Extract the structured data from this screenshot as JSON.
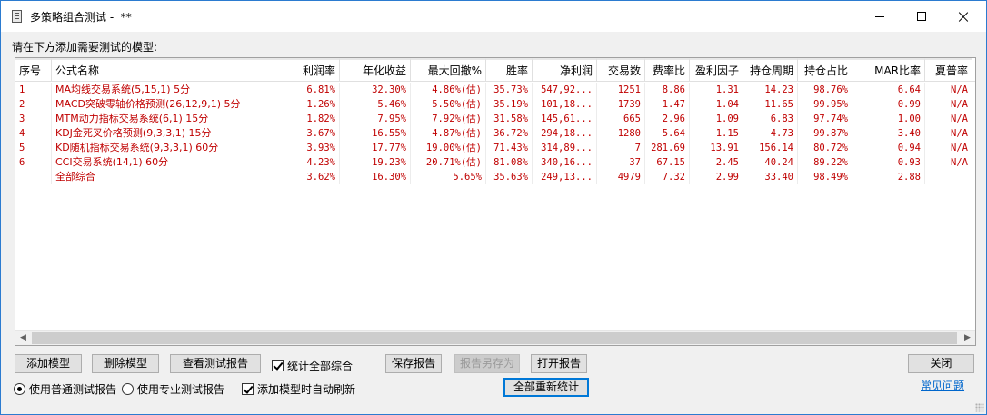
{
  "window": {
    "title": "多策略组合测试 -  **",
    "controls": {
      "minimize": "minimize",
      "maximize": "maximize",
      "close": "×"
    }
  },
  "instruction": "请在下方添加需要测试的模型:",
  "table": {
    "columns": [
      {
        "key": "idx",
        "label": "序号",
        "align": "l"
      },
      {
        "key": "name",
        "label": "公式名称",
        "align": "l"
      },
      {
        "key": "profit_rate",
        "label": "利润率",
        "align": "r"
      },
      {
        "key": "annual",
        "label": "年化收益",
        "align": "r"
      },
      {
        "key": "max_dd",
        "label": "最大回撤%",
        "align": "r"
      },
      {
        "key": "win_rate",
        "label": "胜率",
        "align": "r"
      },
      {
        "key": "net_profit",
        "label": "净利润",
        "align": "r"
      },
      {
        "key": "trades",
        "label": "交易数",
        "align": "r"
      },
      {
        "key": "fee_ratio",
        "label": "费率比",
        "align": "r"
      },
      {
        "key": "profit_factor",
        "label": "盈利因子",
        "align": "r"
      },
      {
        "key": "hold_period",
        "label": "持仓周期",
        "align": "r"
      },
      {
        "key": "hold_ratio",
        "label": "持仓占比",
        "align": "r"
      },
      {
        "key": "mar",
        "label": "MAR比率",
        "align": "r"
      },
      {
        "key": "sharpe",
        "label": "夏普率",
        "align": "r"
      }
    ],
    "rows": [
      {
        "idx": "1",
        "name": "MA均线交易系统(5,15,1) 5分",
        "profit_rate": "6.81%",
        "annual": "32.30%",
        "max_dd": "4.86%(估)",
        "win_rate": "35.73%",
        "net_profit": "547,92...",
        "trades": "1251",
        "fee_ratio": "8.86",
        "profit_factor": "1.31",
        "hold_period": "14.23",
        "hold_ratio": "98.76%",
        "mar": "6.64",
        "sharpe": "N/A"
      },
      {
        "idx": "2",
        "name": "MACD突破零轴价格预测(26,12,9,1) 5分",
        "profit_rate": "1.26%",
        "annual": "5.46%",
        "max_dd": "5.50%(估)",
        "win_rate": "35.19%",
        "net_profit": "101,18...",
        "trades": "1739",
        "fee_ratio": "1.47",
        "profit_factor": "1.04",
        "hold_period": "11.65",
        "hold_ratio": "99.95%",
        "mar": "0.99",
        "sharpe": "N/A"
      },
      {
        "idx": "3",
        "name": "MTM动力指标交易系统(6,1) 15分",
        "profit_rate": "1.82%",
        "annual": "7.95%",
        "max_dd": "7.92%(估)",
        "win_rate": "31.58%",
        "net_profit": "145,61...",
        "trades": "665",
        "fee_ratio": "2.96",
        "profit_factor": "1.09",
        "hold_period": "6.83",
        "hold_ratio": "97.74%",
        "mar": "1.00",
        "sharpe": "N/A"
      },
      {
        "idx": "4",
        "name": "KDJ金死叉价格预测(9,3,3,1) 15分",
        "profit_rate": "3.67%",
        "annual": "16.55%",
        "max_dd": "4.87%(估)",
        "win_rate": "36.72%",
        "net_profit": "294,18...",
        "trades": "1280",
        "fee_ratio": "5.64",
        "profit_factor": "1.15",
        "hold_period": "4.73",
        "hold_ratio": "99.87%",
        "mar": "3.40",
        "sharpe": "N/A"
      },
      {
        "idx": "5",
        "name": "KD随机指标交易系统(9,3,3,1) 60分",
        "profit_rate": "3.93%",
        "annual": "17.77%",
        "max_dd": "19.00%(估)",
        "win_rate": "71.43%",
        "net_profit": "314,89...",
        "trades": "7",
        "fee_ratio": "281.69",
        "profit_factor": "13.91",
        "hold_period": "156.14",
        "hold_ratio": "80.72%",
        "mar": "0.94",
        "sharpe": "N/A"
      },
      {
        "idx": "6",
        "name": "CCI交易系统(14,1) 60分",
        "profit_rate": "4.23%",
        "annual": "19.23%",
        "max_dd": "20.71%(估)",
        "win_rate": "81.08%",
        "net_profit": "340,16...",
        "trades": "37",
        "fee_ratio": "67.15",
        "profit_factor": "2.45",
        "hold_period": "40.24",
        "hold_ratio": "89.22%",
        "mar": "0.93",
        "sharpe": "N/A"
      },
      {
        "idx": "",
        "name": "全部综合",
        "profit_rate": "3.62%",
        "annual": "16.30%",
        "max_dd": "5.65%",
        "win_rate": "35.63%",
        "net_profit": "249,13...",
        "trades": "4979",
        "fee_ratio": "7.32",
        "profit_factor": "2.99",
        "hold_period": "33.40",
        "hold_ratio": "98.49%",
        "mar": "2.88",
        "sharpe": ""
      }
    ]
  },
  "buttons": {
    "add_model": "添加模型",
    "delete_model": "删除模型",
    "view_report": "查看测试报告",
    "save_report": "保存报告",
    "save_as": "报告另存为",
    "open_report": "打开报告",
    "close": "关闭",
    "recalc_all": "全部重新统计"
  },
  "options": {
    "stat_all_label": "统计全部综合",
    "stat_all_checked": true,
    "auto_refresh_label": "添加模型时自动刷新",
    "auto_refresh_checked": true,
    "radio_normal_label": "使用普通测试报告",
    "radio_pro_label": "使用专业测试报告",
    "selected_report_type": "normal"
  },
  "faq_link": "常见问题",
  "colors": {
    "row_text": "#c00000",
    "link": "#0066cc",
    "window_border": "#2b7bd0",
    "default_button_border": "#0078d7"
  }
}
